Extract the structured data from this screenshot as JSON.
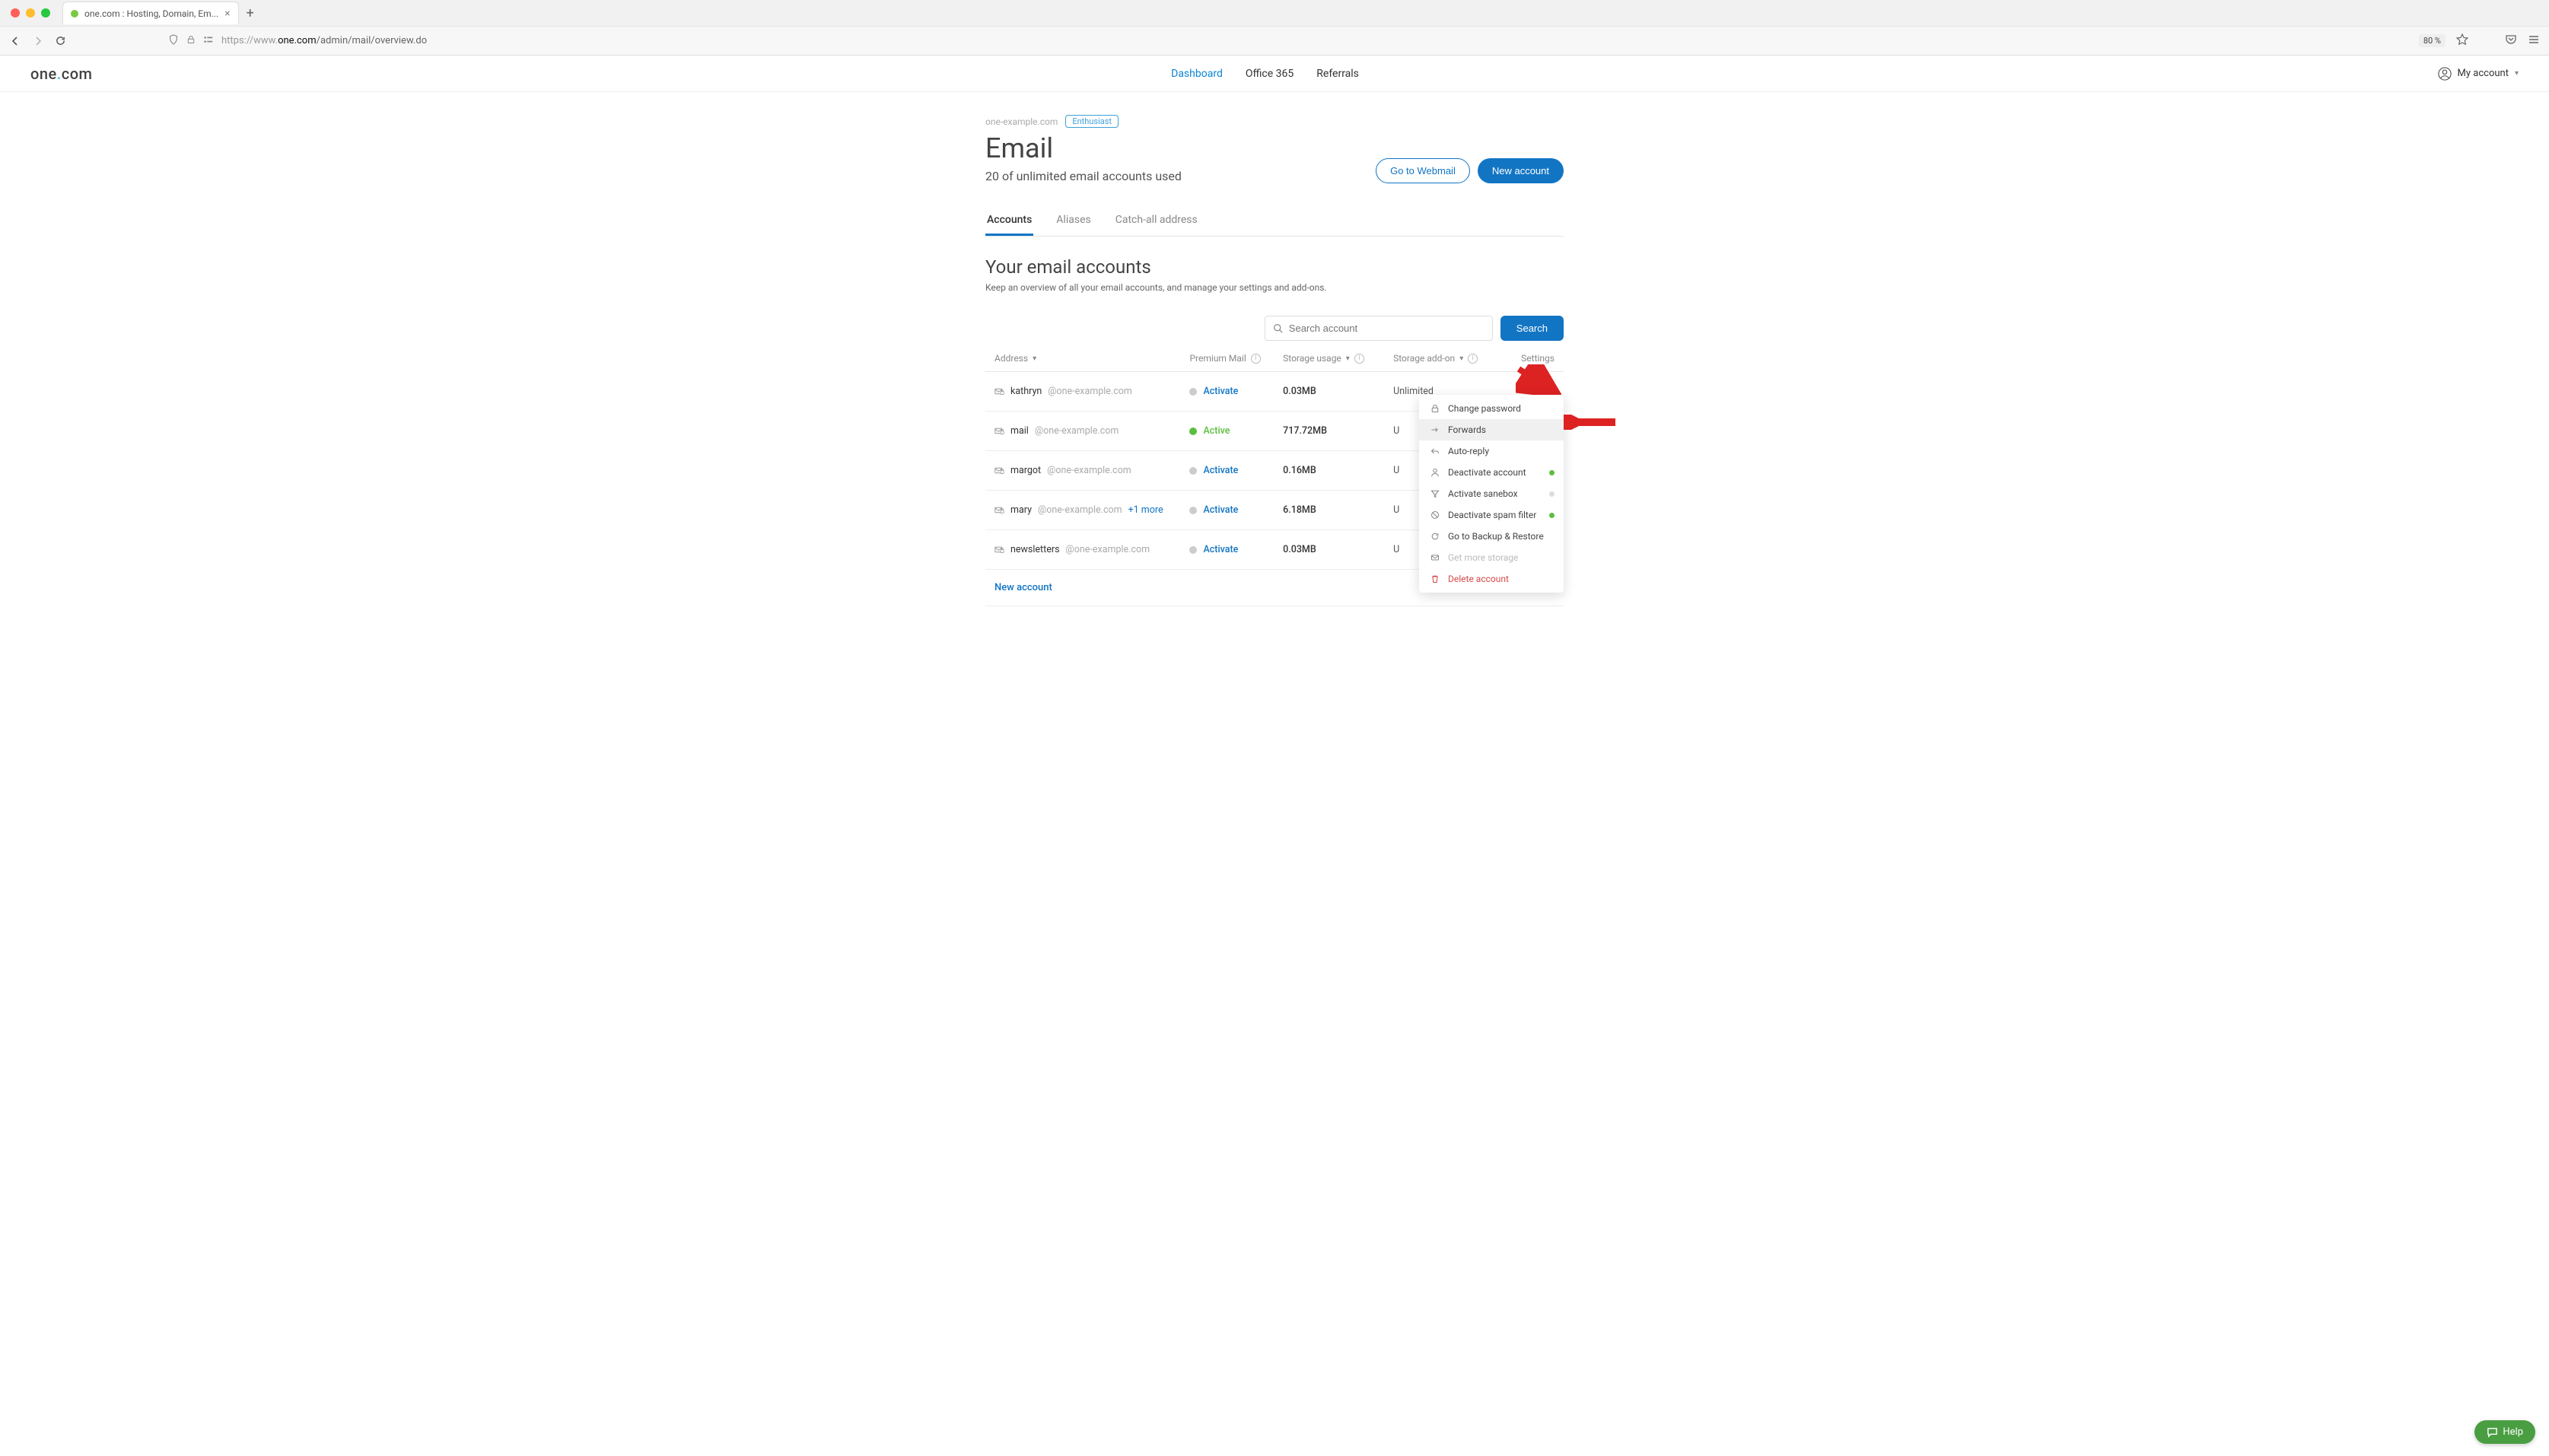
{
  "browser": {
    "tab_title": "one.com : Hosting, Domain, Em...",
    "url_pre": "https://www.",
    "url_host": "one.com",
    "url_path": "/admin/mail/overview.do",
    "zoom": "80 %"
  },
  "header": {
    "logo_pre": "one",
    "logo_post": "com",
    "nav": {
      "dashboard": "Dashboard",
      "office": "Office 365",
      "referrals": "Referrals"
    },
    "account": "My account"
  },
  "page": {
    "domain": "one-example.com",
    "badge": "Enthusiast",
    "title": "Email",
    "subtitle": "20 of unlimited email accounts used",
    "go_webmail": "Go to Webmail",
    "new_account": "New account",
    "tabs": {
      "accounts": "Accounts",
      "aliases": "Aliases",
      "catchall": "Catch-all address"
    },
    "section_title": "Your email accounts",
    "section_sub": "Keep an overview of all your email accounts, and manage your settings and add-ons.",
    "search_placeholder": "Search account",
    "search_btn": "Search",
    "cols": {
      "address": "Address",
      "premium": "Premium Mail",
      "usage": "Storage usage",
      "addon": "Storage add-on",
      "settings": "Settings"
    },
    "rows": [
      {
        "local": "kathryn",
        "domain": "@one-example.com",
        "more": "",
        "pm_status": "inactive",
        "pm_label": "Activate",
        "usage": "0.03MB",
        "addon": "Unlimited"
      },
      {
        "local": "mail",
        "domain": "@one-example.com",
        "more": "",
        "pm_status": "active",
        "pm_label": "Active",
        "usage": "717.72MB",
        "addon": "U"
      },
      {
        "local": "margot",
        "domain": "@one-example.com",
        "more": "",
        "pm_status": "inactive",
        "pm_label": "Activate",
        "usage": "0.16MB",
        "addon": "U"
      },
      {
        "local": "mary",
        "domain": "@one-example.com",
        "more": "+1 more",
        "pm_status": "inactive",
        "pm_label": "Activate",
        "usage": "6.18MB",
        "addon": "U"
      },
      {
        "local": "newsletters",
        "domain": "@one-example.com",
        "more": "",
        "pm_status": "inactive",
        "pm_label": "Activate",
        "usage": "0.03MB",
        "addon": "U"
      }
    ],
    "new_account_link": "New account"
  },
  "dropdown": {
    "change_password": "Change password",
    "forwards": "Forwards",
    "auto_reply": "Auto-reply",
    "deactivate_account": "Deactivate account",
    "activate_sanebox": "Activate sanebox",
    "deactivate_spam": "Deactivate spam filter",
    "backup_restore": "Go to Backup & Restore",
    "get_storage": "Get more storage",
    "delete_account": "Delete account"
  },
  "help": "Help"
}
